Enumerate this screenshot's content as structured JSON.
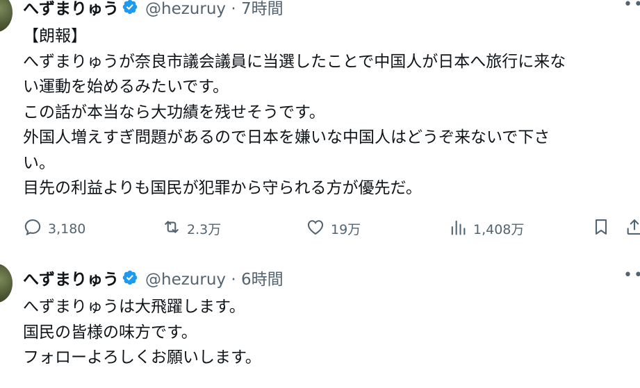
{
  "tweets": [
    {
      "author": "へずまりゅう",
      "handle": "@hezuruy · 7時間",
      "lines": [
        "【朗報】",
        "へずまりゅうが奈良市議会議員に当選したことで中国人が日本へ旅行に来な",
        "い運動を始めるみたいです。",
        "この話が本当なら大功績を残せそうです。",
        "外国人増えすぎ問題があるので日本を嫌いな中国人はどうぞ来ないで下さ",
        "い。",
        "目先の利益よりも国民が犯罪から守られる方が優先だ。"
      ],
      "stats": {
        "replies": "3,180",
        "reposts": "2.3万",
        "likes": "19万",
        "views": "1,408万"
      }
    },
    {
      "author": "へずまりゅう",
      "handle": "@hezuruy · 6時間",
      "lines": [
        "へずまりゅうは大飛躍します。",
        "国民の皆様の味方です。",
        "フォローよろしくお願いします。"
      ]
    }
  ],
  "colors": {
    "text": "#0f1419",
    "muted": "#536471",
    "verified": "#1d9bf0"
  },
  "icons": [
    "avatar",
    "verified-badge-icon",
    "more-icon",
    "reply-icon",
    "repost-icon",
    "like-icon",
    "views-icon",
    "bookmark-icon",
    "share-icon"
  ]
}
